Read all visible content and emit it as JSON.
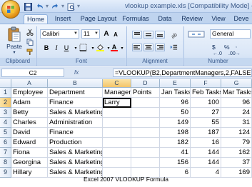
{
  "window": {
    "title": "vlookup example.xls  [Compatibility Mode] -"
  },
  "tabs": [
    {
      "label": "Home",
      "active": true
    },
    {
      "label": "Insert"
    },
    {
      "label": "Page Layout"
    },
    {
      "label": "Formulas"
    },
    {
      "label": "Data"
    },
    {
      "label": "Review"
    },
    {
      "label": "View"
    },
    {
      "label": "Deve"
    }
  ],
  "ribbon": {
    "clipboard": {
      "paste_label": "Paste",
      "group_label": "Clipboard"
    },
    "font": {
      "font_name": "Calibri",
      "font_size": "11",
      "group_label": "Font",
      "bold": "B",
      "italic": "I",
      "underline": "U",
      "grow": "A",
      "shrink": "A"
    },
    "alignment": {
      "group_label": "Alignment"
    },
    "number": {
      "format": "General",
      "currency": "$",
      "percent": "%",
      "group_label": "Number"
    },
    "accent_color": "#15325f"
  },
  "formula_bar": {
    "name_box": "C2",
    "fx": "fx",
    "formula": "=VLOOKUP(B2,DepartmentManagers,2,FALSE)"
  },
  "sheet": {
    "columns": [
      "A",
      "B",
      "C",
      "D",
      "E",
      "F",
      "G"
    ],
    "rows": [
      {
        "num": "1",
        "cells": [
          "Employee",
          "Department",
          "Manager",
          "Points",
          "Jan Tasks",
          "Feb Tasks",
          "Mar Tasks"
        ]
      },
      {
        "num": "2",
        "cells": [
          "Adam",
          "Finance",
          "Larry",
          "",
          "96",
          "100",
          "96"
        ]
      },
      {
        "num": "3",
        "cells": [
          "Betty",
          "Sales & Marketing",
          "",
          "",
          "50",
          "27",
          "24"
        ]
      },
      {
        "num": "4",
        "cells": [
          "Charles",
          "Administration",
          "",
          "",
          "149",
          "55",
          "31"
        ]
      },
      {
        "num": "5",
        "cells": [
          "David",
          "Finance",
          "",
          "",
          "198",
          "187",
          "124"
        ]
      },
      {
        "num": "6",
        "cells": [
          "Edward",
          "Production",
          "",
          "",
          "182",
          "16",
          "79"
        ]
      },
      {
        "num": "7",
        "cells": [
          "Fiona",
          "Sales & Marketing",
          "",
          "",
          "41",
          "144",
          "162"
        ]
      },
      {
        "num": "8",
        "cells": [
          "Georgina",
          "Sales & Marketing",
          "",
          "",
          "156",
          "144",
          "37"
        ]
      },
      {
        "num": "9",
        "cells": [
          "Hillary",
          "Sales & Marketing",
          "",
          "",
          "6",
          "4",
          "169"
        ]
      }
    ],
    "active_cell": "C2"
  },
  "caption": "Excel 2007 VLOOKUP Formula"
}
